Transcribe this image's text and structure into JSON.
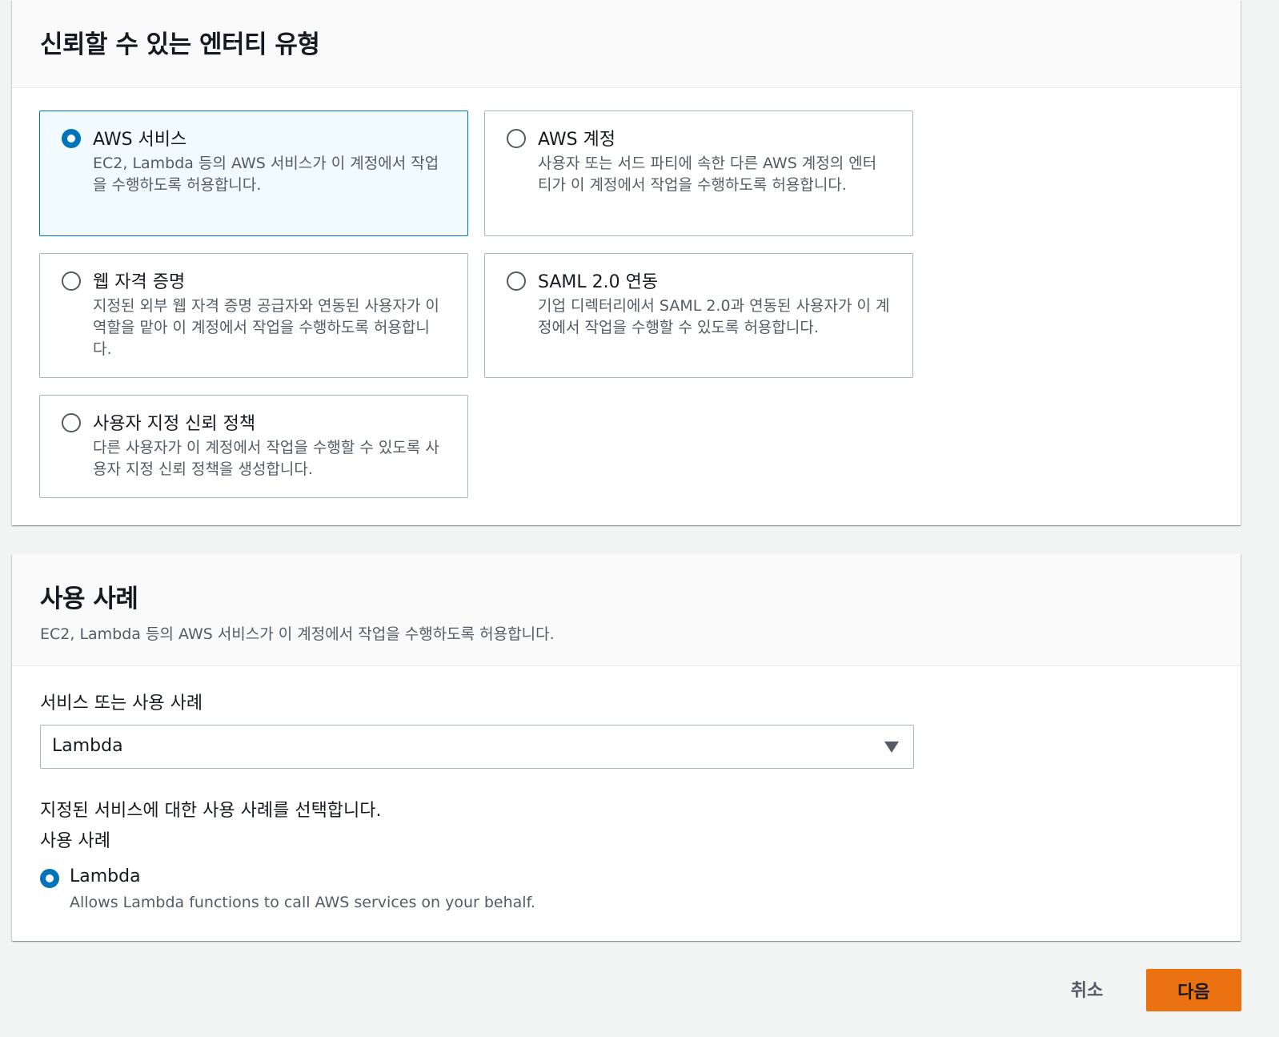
{
  "trust_section": {
    "title": "신뢰할 수 있는 엔터티 유형",
    "options": [
      {
        "title": "AWS 서비스",
        "desc": "EC2, Lambda 등의 AWS 서비스가 이 계정에서 작업을 수행하도록 허용합니다.",
        "selected": true
      },
      {
        "title": "AWS 계정",
        "desc": "사용자 또는 서드 파티에 속한 다른 AWS 계정의 엔터티가 이 계정에서 작업을 수행하도록 허용합니다.",
        "selected": false
      },
      {
        "title": "웹 자격 증명",
        "desc": "지정된 외부 웹 자격 증명 공급자와 연동된 사용자가 이 역할을 맡아 이 계정에서 작업을 수행하도록 허용합니다.",
        "selected": false
      },
      {
        "title": "SAML 2.0 연동",
        "desc": "기업 디렉터리에서 SAML 2.0과 연동된 사용자가 이 계정에서 작업을 수행할 수 있도록 허용합니다.",
        "selected": false
      },
      {
        "title": "사용자 지정 신뢰 정책",
        "desc": "다른 사용자가 이 계정에서 작업을 수행할 수 있도록 사용자 지정 신뢰 정책을 생성합니다.",
        "selected": false
      }
    ]
  },
  "use_case_section": {
    "title": "사용 사례",
    "description": "EC2, Lambda 등의 AWS 서비스가 이 계정에서 작업을 수행하도록 허용합니다.",
    "select_label": "서비스 또는 사용 사례",
    "select_value": "Lambda",
    "helper_text": "지정된 서비스에 대한 사용 사례를 선택합니다.",
    "use_case_label": "사용 사례",
    "option": {
      "label": "Lambda",
      "desc": "Allows Lambda functions to call AWS services on your behalf.",
      "selected": true
    }
  },
  "footer": {
    "cancel_label": "취소",
    "next_label": "다음"
  },
  "colors": {
    "primary_button": "#ec7211",
    "selected_accent": "#0073bb",
    "selected_tile_bg": "#f1faff"
  }
}
